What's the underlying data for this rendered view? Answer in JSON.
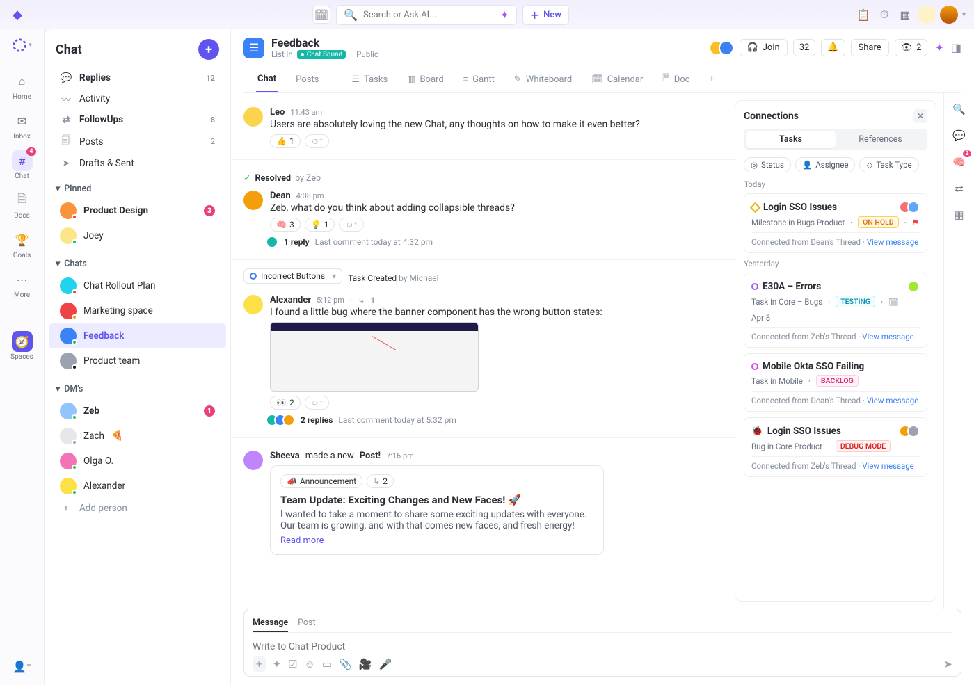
{
  "topbar": {
    "search_placeholder": "Search or Ask AI...",
    "new_label": "New"
  },
  "rail": {
    "items": [
      {
        "key": "home",
        "label": "Home"
      },
      {
        "key": "inbox",
        "label": "Inbox"
      },
      {
        "key": "chat",
        "label": "Chat",
        "badge": "4"
      },
      {
        "key": "docs",
        "label": "Docs"
      },
      {
        "key": "goals",
        "label": "Goals"
      },
      {
        "key": "more",
        "label": "More"
      }
    ],
    "spaces": "Spaces"
  },
  "chatpanel": {
    "title": "Chat",
    "nav": [
      {
        "label": "Replies",
        "count": "12",
        "bold": true
      },
      {
        "label": "Activity"
      },
      {
        "label": "FollowUps",
        "count": "8",
        "bold": true
      },
      {
        "label": "Posts",
        "count": "2"
      },
      {
        "label": "Drafts & Sent"
      }
    ],
    "sections": {
      "pinned": "Pinned",
      "chats": "Chats",
      "dms": "DM's"
    },
    "pinned": [
      {
        "label": "Product Design",
        "pill": "3",
        "bold": true
      },
      {
        "label": "Joey"
      }
    ],
    "chats": [
      {
        "label": "Chat Rollout Plan"
      },
      {
        "label": "Marketing space"
      },
      {
        "label": "Feedback",
        "selected": true
      },
      {
        "label": "Product team"
      }
    ],
    "dms": [
      {
        "label": "Zeb",
        "pill": "1",
        "bold": true
      },
      {
        "label": "Zach",
        "emoji": "🍕"
      },
      {
        "label": "Olga O."
      },
      {
        "label": "Alexander"
      }
    ],
    "add_person": "Add person"
  },
  "header": {
    "title": "Feedback",
    "listin": "List in",
    "folder": "Chat Squad",
    "visibility": "Public",
    "join": "Join",
    "count": "32",
    "share": "Share",
    "followers_count": "2"
  },
  "tabs": [
    "Chat",
    "Posts",
    "Tasks",
    "Board",
    "Gantt",
    "Whiteboard",
    "Calendar",
    "Doc"
  ],
  "messages": {
    "leo": {
      "name": "Leo",
      "time": "11:43 am",
      "text": "Users are absolutely loving the new Chat, any thoughts on how to make it even better?",
      "react_count": "1"
    },
    "resolved": {
      "label": "Resolved",
      "by": "by Zeb"
    },
    "dean": {
      "name": "Dean",
      "time": "4:08 pm",
      "text": "Zeb, what do you think about adding collapsible threads?",
      "r1": "3",
      "r2": "1",
      "reply_count": "1 reply",
      "reply_meta": "Last comment today at 4:32 pm"
    },
    "task": {
      "pill": "Incorrect Buttons",
      "created": "Task Created",
      "by": "by Michael"
    },
    "alex": {
      "name": "Alexander",
      "time": "5:12 pm",
      "sub": "1",
      "text": "I found a little bug where the banner component has the wrong button states:",
      "react_count": "2",
      "reply_count": "2 replies",
      "reply_meta": "Last comment today at 5:32 pm"
    },
    "sheeva": {
      "name": "Sheeva",
      "made": " made a new ",
      "post": "Post!",
      "time": "7:16 pm"
    },
    "postcard": {
      "chip1": "Announcement",
      "chip2_count": "2",
      "title": "Team Update: Exciting Changes and New Faces! 🚀",
      "body": "I wanted to take a moment to share some exciting updates with everyone. Our team is growing, and with that comes new faces, and fresh energy!",
      "readmore": "Read more"
    }
  },
  "composer": {
    "tabs": [
      "Message",
      "Post"
    ],
    "placeholder": "Write to Chat Product"
  },
  "connections": {
    "title": "Connections",
    "segments": [
      "Tasks",
      "References"
    ],
    "filters": [
      "Status",
      "Assignee",
      "Task Type"
    ],
    "groups": {
      "today": "Today",
      "yesterday": "Yesterday"
    },
    "cards": [
      {
        "group": "today",
        "title": "Login SSO Issues",
        "meta": "Milestone in Bugs Product",
        "tag": "ON HOLD",
        "flag": true,
        "footer_from": "Connected from Dean's Thread",
        "view": "View message",
        "iconcolor": "#eab308"
      },
      {
        "group": "yesterday",
        "title": "E30A – Errors",
        "meta": "Task in Core – Bugs",
        "tag": "TESTING",
        "date": "Apr 8",
        "footer_from": "Connected from Zeb's Thread",
        "view": "View message",
        "iconcolor": "#a855f7"
      },
      {
        "group": "yesterday",
        "title": "Mobile Okta SSO Failing",
        "meta": "Task in Mobile",
        "tag": "BACKLOG",
        "footer_from": "Connected from Dean's Thread",
        "view": "View message",
        "iconcolor": "#d946ef"
      },
      {
        "group": "yesterday",
        "title": "Login SSO Issues",
        "meta": "Bug in Core Product",
        "tag": "DEBUG MODE",
        "footer_from": "Connected from Zeb's Thread",
        "view": "View message",
        "bug": true
      }
    ]
  },
  "rightrail_badge": "2"
}
